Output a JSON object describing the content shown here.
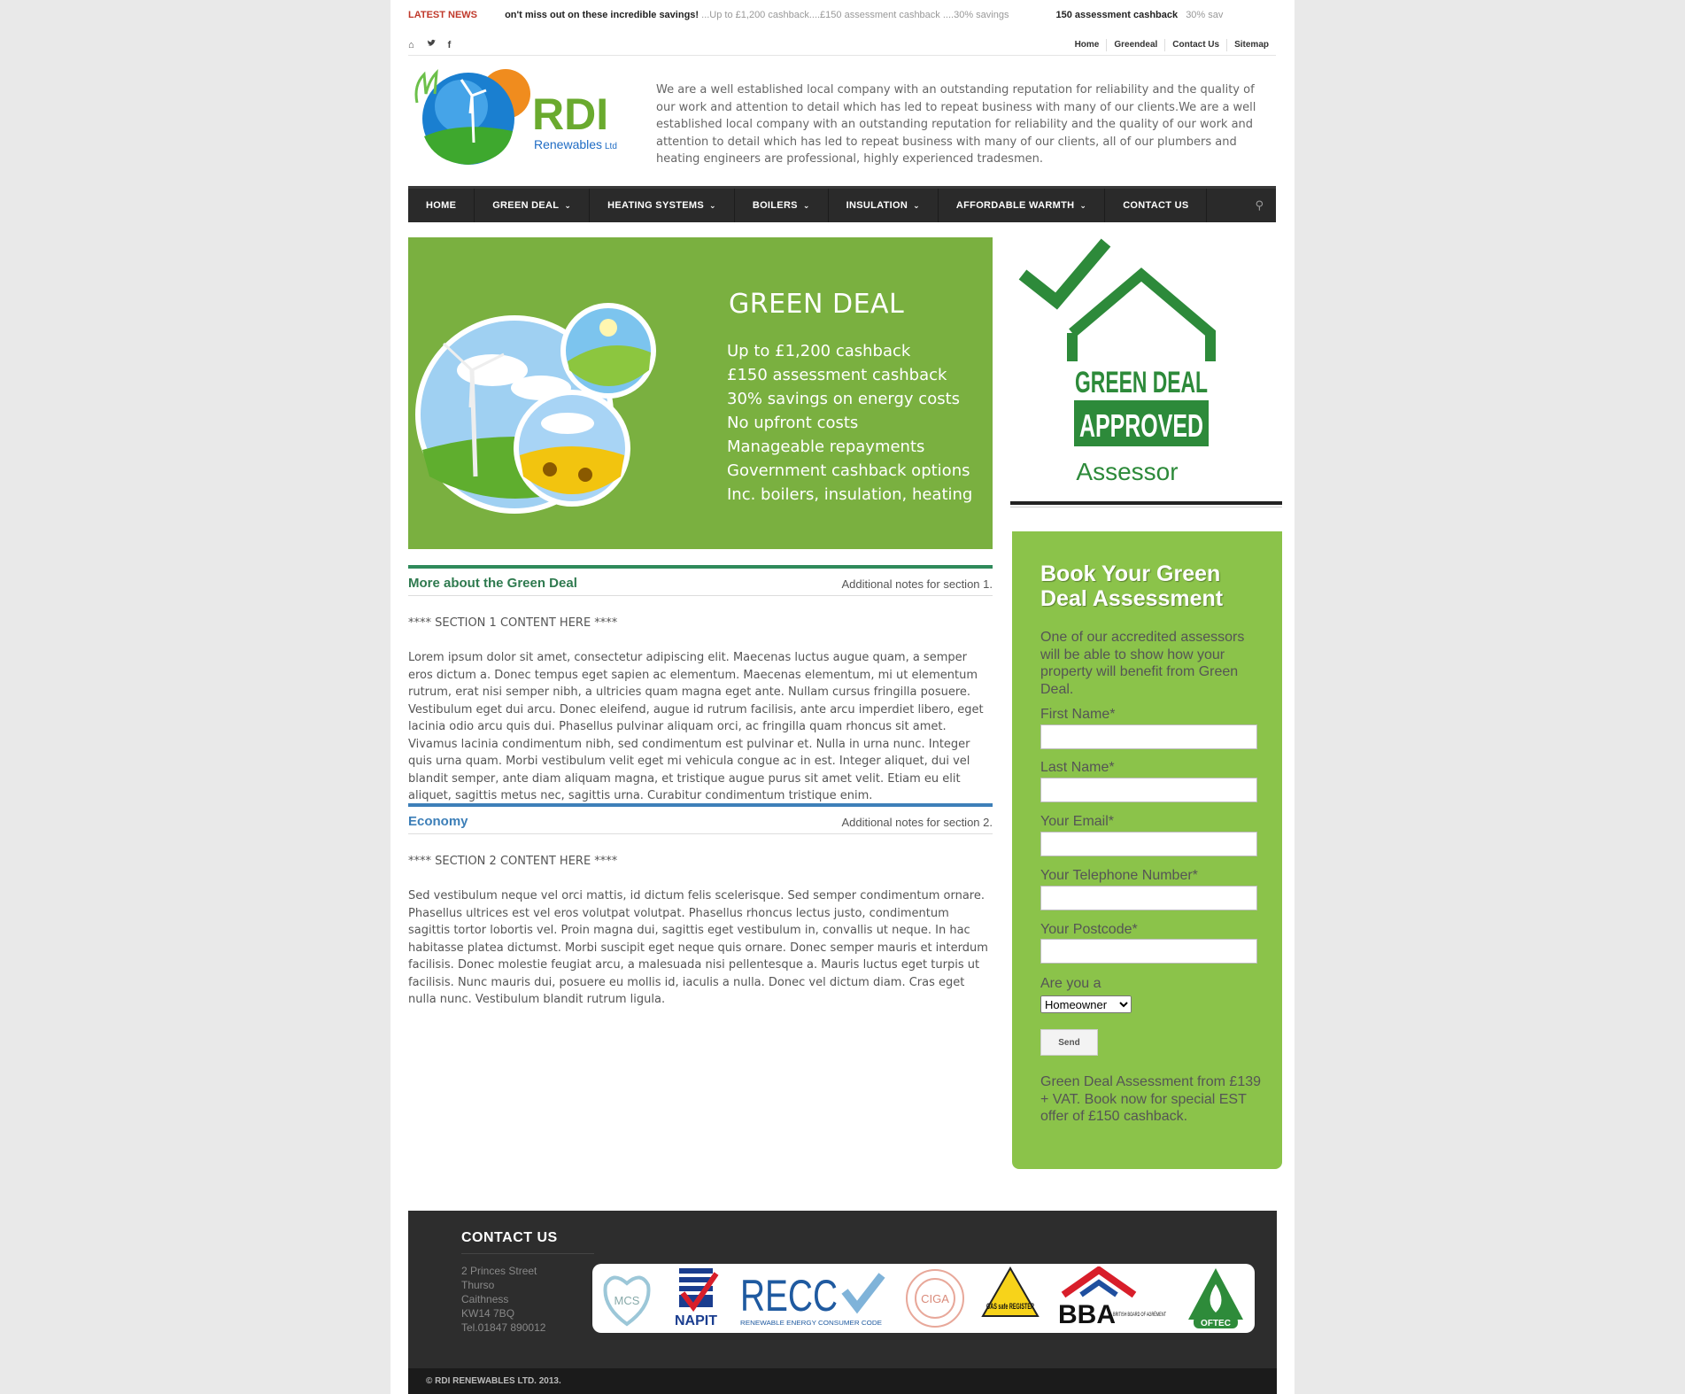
{
  "ticker": {
    "label": "LATEST NEWS",
    "item1_bold": "on't miss out on these incredible savings!",
    "item1_rest": "...Up to £1,200 cashback....£150 assessment cashback ....30% savings",
    "item2_bold": "150 assessment cashback",
    "item2_rest": "30% sav"
  },
  "topbar": {
    "social": [
      "⌂",
      "🐦",
      "f"
    ],
    "links": [
      "Home",
      "Greendeal",
      "Contact Us",
      "Sitemap"
    ]
  },
  "logo": {
    "name": "RDI",
    "sub": "Renewables",
    "suffix": "Ltd"
  },
  "intro": "We are a well established local company with an outstanding reputation for reliability and the quality of our work and attention to detail which has led to repeat business with many of our clients.We are a well established local company with an outstanding reputation for reliability and the quality of our work and attention to detail which has led to repeat business with many of our clients, all of our plumbers and heating engineers are professional, highly experienced tradesmen.",
  "nav": {
    "items": [
      {
        "label": "HOME",
        "dropdown": false
      },
      {
        "label": "GREEN DEAL",
        "dropdown": true
      },
      {
        "label": "HEATING SYSTEMS",
        "dropdown": true
      },
      {
        "label": "BOILERS",
        "dropdown": true
      },
      {
        "label": "INSULATION",
        "dropdown": true
      },
      {
        "label": "AFFORDABLE WARMTH",
        "dropdown": true
      },
      {
        "label": "CONTACT US",
        "dropdown": false
      }
    ],
    "caret": "⌄",
    "search_icon": "⚲"
  },
  "banner": {
    "title": "GREEN DEAL",
    "points": [
      "Up to £1,200 cashback",
      "£150 assessment cashback",
      "30% savings on energy costs",
      "No upfront costs",
      "Manageable repayments",
      "Government cashback options",
      "Inc. boilers, insulation, heating"
    ]
  },
  "approved": {
    "line1": "GREEN DEAL",
    "line2": "APPROVED",
    "line3": "Assessor"
  },
  "sections": [
    {
      "title": "More about the Green Deal",
      "note": "Additional notes for section 1.",
      "placeholder": "**** SECTION 1 CONTENT HERE ****",
      "body": "Lorem ipsum dolor sit amet, consectetur adipiscing elit. Maecenas luctus augue quam, a semper eros dictum a. Donec tempus eget sapien ac elementum. Maecenas elementum, mi ut elementum rutrum, erat nisi semper nibh, a ultricies quam magna eget ante. Nullam cursus fringilla posuere. Vestibulum eget dui arcu. Donec eleifend, augue id rutrum facilisis, ante arcu imperdiet libero, eget lacinia odio arcu quis dui. Phasellus pulvinar aliquam orci, ac fringilla quam rhoncus sit amet. Vivamus lacinia condimentum nibh, sed condimentum est pulvinar et. Nulla in urna nunc. Integer quis urna quam. Morbi vestibulum velit eget mi vehicula congue ac in est. Integer aliquet, dui vel blandit semper, ante diam aliquam magna, et tristique augue purus sit amet velit. Etiam eu elit aliquet, sagittis metus nec, sagittis urna. Curabitur condimentum tristique enim."
    },
    {
      "title": "Economy",
      "note": "Additional notes for section 2.",
      "placeholder": "**** SECTION 2 CONTENT HERE ****",
      "body": "Sed vestibulum neque vel orci mattis, id dictum felis scelerisque. Sed semper condimentum ornare. Phasellus ultrices est vel eros volutpat volutpat. Phasellus rhoncus lectus justo, condimentum sagittis tortor lobortis vel. Proin magna dui, sagittis eget vestibulum in, convallis ut neque. In hac habitasse platea dictumst. Morbi suscipit eget neque quis ornare. Donec semper mauris et interdum facilisis. Donec molestie feugiat arcu, a malesuada nisi pellentesque a. Mauris luctus eget turpis ut facilisis. Nunc mauris dui, posuere eu mollis id, iaculis a nulla. Donec vel dictum diam. Cras eget nulla nunc. Vestibulum blandit rutrum ligula."
    }
  ],
  "form": {
    "title": "Book Your Green Deal Assessment",
    "desc": "One of our accredited assessors will be able to show how your property will benefit from Green Deal.",
    "fields": [
      {
        "label": "First Name*",
        "value": ""
      },
      {
        "label": "Last Name*",
        "value": ""
      },
      {
        "label": "Your Email*",
        "value": ""
      },
      {
        "label": "Your Telephone Number*",
        "value": ""
      },
      {
        "label": "Your Postcode*",
        "value": ""
      }
    ],
    "select_label": "Are you a",
    "select_value": "Homeowner",
    "send": "Send",
    "footer": "Green Deal Assessment from £139 + VAT. Book now for special EST offer of £150 cashback."
  },
  "footer": {
    "title": "CONTACT US",
    "address": [
      "2 Princes Street",
      "Thurso",
      "Caithness",
      "KW14 7BQ",
      "Tel.01847 890012"
    ],
    "logos": [
      "MCS",
      "NAPIT",
      "RECC",
      "CIGA",
      "GAS safe REGISTER",
      "BBA",
      "OFTEC"
    ],
    "recc_sub": "RENEWABLE ENERGY CONSUMER CODE",
    "bba_sub": "BRITISH BOARD OF AGRÉMENT"
  },
  "copyright": "© RDI RENEWABLES LTD. 2013.",
  "colors": {
    "nav_bg": "#2a2a2a",
    "banner_green": "#7ab040",
    "form_green": "#8bc34a",
    "section1": "#2f8a5b",
    "section2": "#3d7fb8",
    "ticker_label": "#c0392b"
  }
}
